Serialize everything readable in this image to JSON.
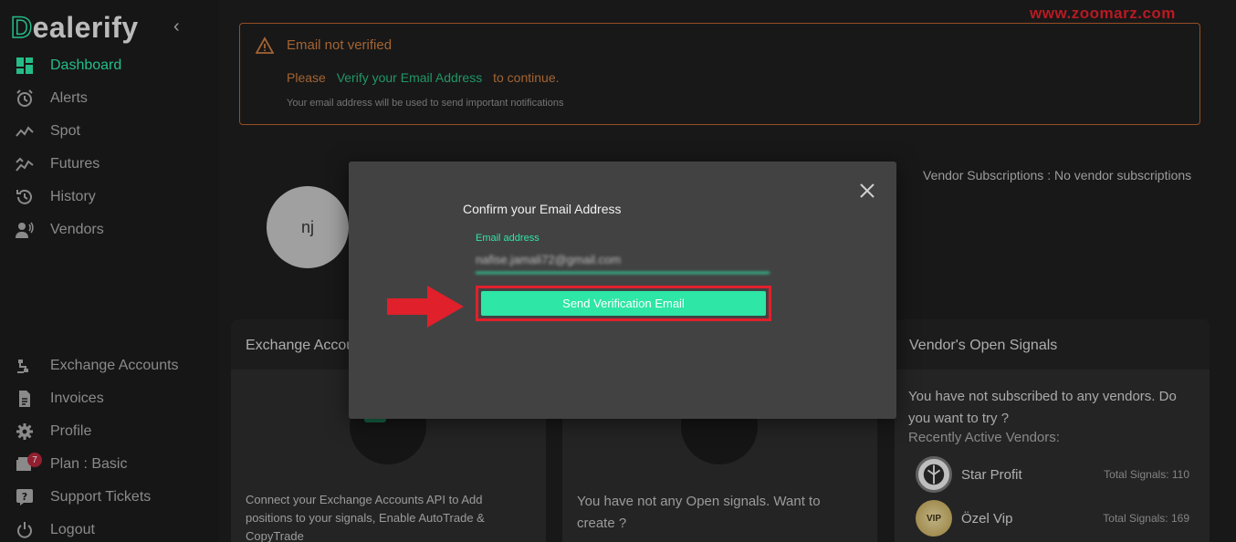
{
  "sidebar": {
    "brand": "Dealerify",
    "collapse_icon": "chevron-left-icon",
    "items_top": [
      {
        "label": "Dashboard",
        "icon": "dashboard-icon",
        "active": true
      },
      {
        "label": "Alerts",
        "icon": "alarm-clock-icon"
      },
      {
        "label": "Spot",
        "icon": "trend-line-icon"
      },
      {
        "label": "Futures",
        "icon": "futures-chart-icon"
      },
      {
        "label": "History",
        "icon": "history-icon"
      },
      {
        "label": "Vendors",
        "icon": "vendors-icon"
      }
    ],
    "items_bottom": [
      {
        "label": "Exchange Accounts",
        "icon": "plug-icon"
      },
      {
        "label": "Invoices",
        "icon": "invoice-icon"
      },
      {
        "label": "Profile",
        "icon": "gear-icon"
      },
      {
        "label": "Plan : Basic",
        "icon": "wallet-icon",
        "badge": "7"
      },
      {
        "label": "Support Tickets",
        "icon": "help-icon"
      },
      {
        "label": "Logout",
        "icon": "power-icon"
      }
    ]
  },
  "alert": {
    "title": "Email not verified",
    "prefix": "Please",
    "link": "Verify your Email Address",
    "suffix": "to continue.",
    "note": "Your email address will be used to send important notifications",
    "color": "#c97a3e"
  },
  "watermark": "www.zoomarz.com",
  "profile": {
    "initials": "nj",
    "vendor_subscriptions": "Vendor Subscriptions : No vendor subscriptions"
  },
  "cards": {
    "exchange": {
      "title": "Exchange Accounts",
      "text": "Connect your Exchange Accounts API to Add positions to your signals, Enable AutoTrade & CopyTrade"
    },
    "open_signals": {
      "text": "You have not any Open signals. Want to create ?"
    },
    "vendor_signals": {
      "title": "Vendor's Open Signals",
      "text": "You have not subscribed to any vendors. Do you want to try ?",
      "recent": "Recently Active Vendors:",
      "vendors": [
        {
          "name": "Star Profit",
          "total": "Total Signals: 110"
        },
        {
          "name": "Özel Vip",
          "total": "Total Signals: 169",
          "logo_text": "VIP"
        }
      ]
    }
  },
  "modal": {
    "title": "Confirm your Email Address",
    "email_label": "Email address",
    "email_value": "nafise.jamali72@gmail.com",
    "send_button": "Send Verification Email"
  },
  "colors": {
    "accent": "#2ee6a6",
    "highlight": "#e0202b",
    "warning": "#c97a3e"
  }
}
